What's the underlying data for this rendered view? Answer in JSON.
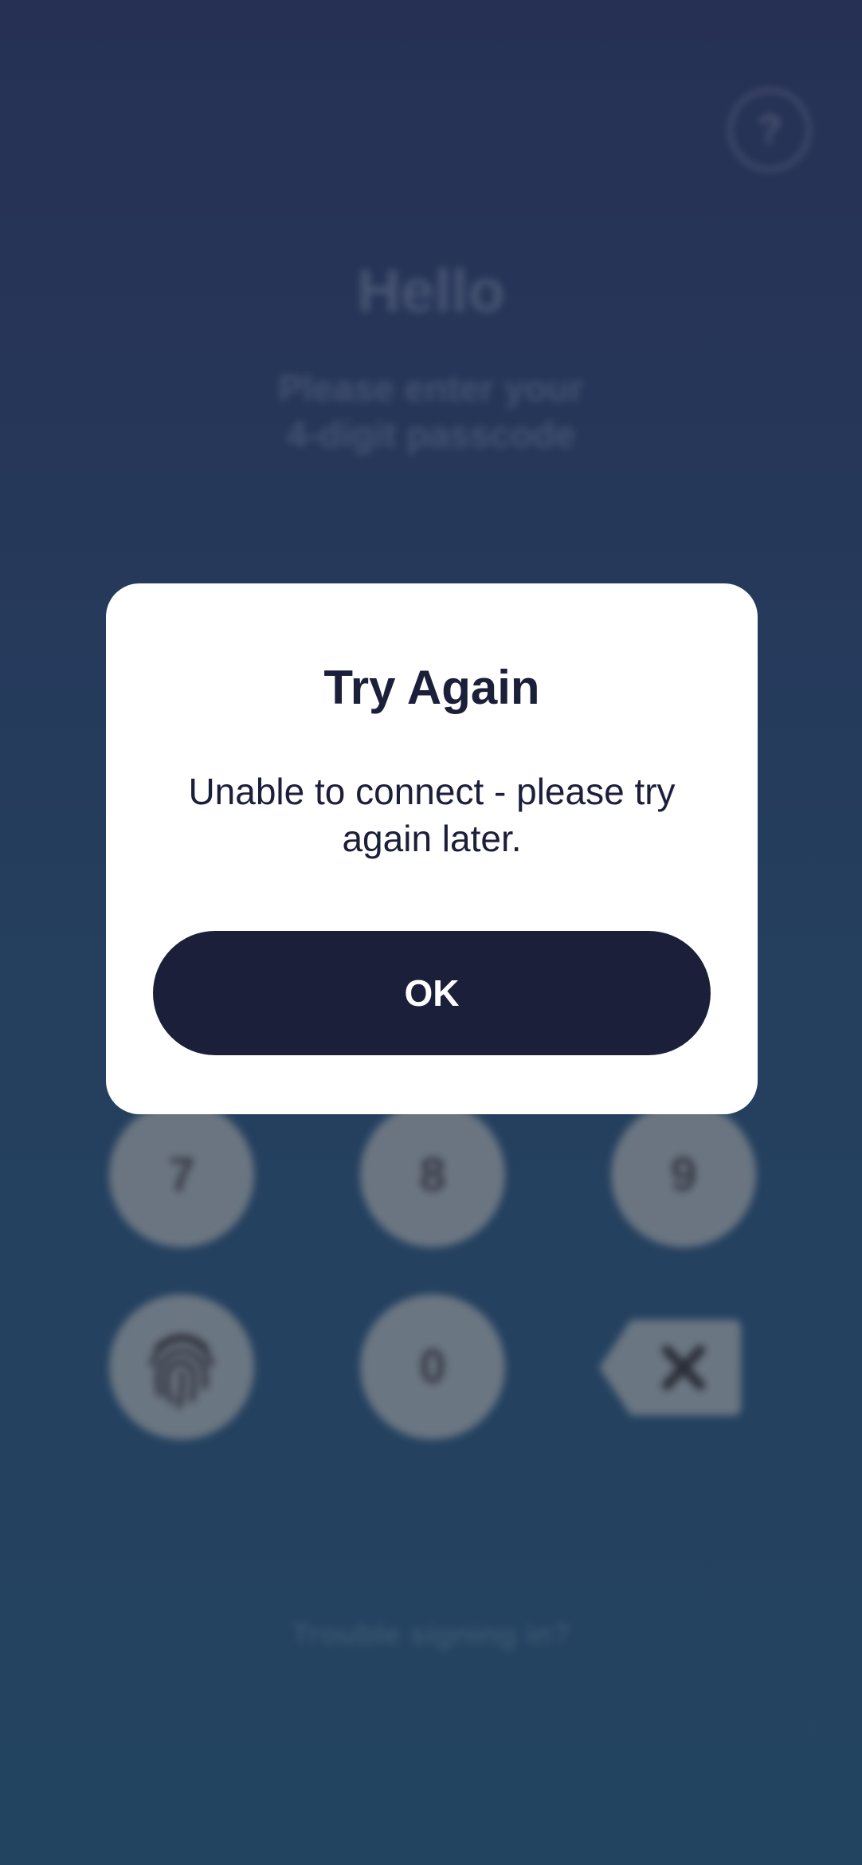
{
  "login": {
    "greeting": "Hello",
    "prompt_line1": "Please enter your",
    "prompt_line2": "4-digit passcode",
    "help_label": "?",
    "trouble_link": "Trouble signing in?",
    "keypad": {
      "key_7": "7",
      "key_8": "8",
      "key_9": "9",
      "key_0": "0"
    },
    "icons": {
      "fingerprint": "fingerprint-icon",
      "backspace": "backspace-icon",
      "help": "question-mark-icon"
    }
  },
  "dialog": {
    "title": "Try Again",
    "message": "Unable to connect - please try again later.",
    "ok_label": "OK"
  },
  "colors": {
    "background_top": "#263055",
    "background_bottom": "#234461",
    "dialog_bg": "#ffffff",
    "text_dark": "#1c1f3a",
    "button_bg": "#1c1f3a",
    "button_text": "#ffffff"
  }
}
